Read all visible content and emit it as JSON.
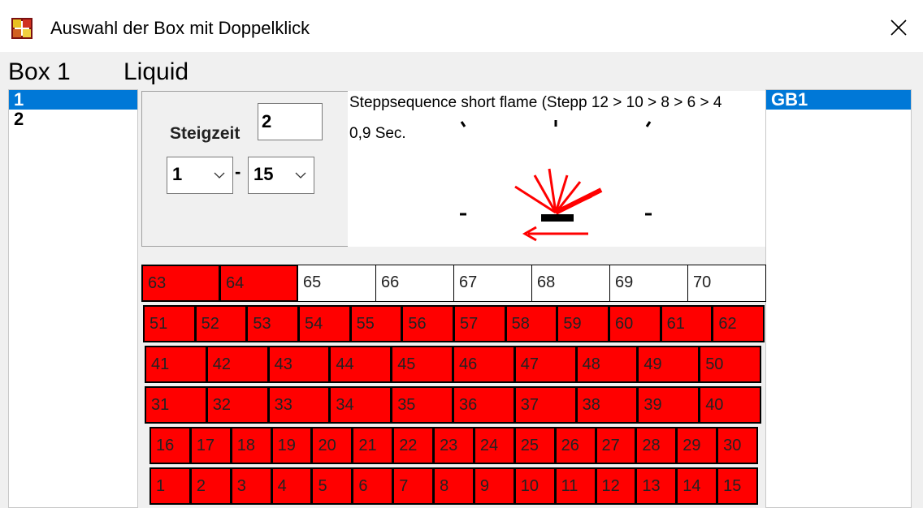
{
  "window": {
    "title": "Auswahl der Box mit Doppelklick"
  },
  "menu": {
    "box": "Box 1",
    "liquid": "Liquid"
  },
  "left_list": {
    "items": [
      "1",
      "2"
    ],
    "selected": "1"
  },
  "right_list": {
    "items": [
      "GB1"
    ],
    "selected": "GB1"
  },
  "controls": {
    "steigzeit_label": "Steigzeit",
    "steigzeit_value": "2",
    "range_from": "1",
    "range_to": "15",
    "dash": "-"
  },
  "preview": {
    "sequence_text": "Steppsequence short flame (Stepp 12 > 10 > 8 > 6 > 4",
    "duration_text": "0,9 Sec."
  },
  "colors": {
    "active": "#ff0000",
    "inactive": "#ffffff",
    "selection": "#0078d7"
  },
  "icons": {
    "app": "fireworks-app-icon",
    "close": "close-icon",
    "dropdown": "chevron-down-icon"
  },
  "grid": {
    "rows": [
      {
        "cells": [
          "63",
          "64",
          "65",
          "66",
          "67",
          "68",
          "69",
          "70"
        ],
        "active": [
          "63",
          "64"
        ]
      },
      {
        "cells": [
          "51",
          "52",
          "53",
          "54",
          "55",
          "56",
          "57",
          "58",
          "59",
          "60",
          "61",
          "62"
        ],
        "active": [
          "51",
          "52",
          "53",
          "54",
          "55",
          "56",
          "57",
          "58",
          "59",
          "60",
          "61",
          "62"
        ]
      },
      {
        "cells": [
          "41",
          "42",
          "43",
          "44",
          "45",
          "46",
          "47",
          "48",
          "49",
          "50"
        ],
        "active": [
          "41",
          "42",
          "43",
          "44",
          "45",
          "46",
          "47",
          "48",
          "49",
          "50"
        ]
      },
      {
        "cells": [
          "31",
          "32",
          "33",
          "34",
          "35",
          "36",
          "37",
          "38",
          "39",
          "40"
        ],
        "active": [
          "31",
          "32",
          "33",
          "34",
          "35",
          "36",
          "37",
          "38",
          "39",
          "40"
        ]
      },
      {
        "cells": [
          "16",
          "17",
          "18",
          "19",
          "20",
          "21",
          "22",
          "23",
          "24",
          "25",
          "26",
          "27",
          "28",
          "29",
          "30"
        ],
        "active": [
          "16",
          "17",
          "18",
          "19",
          "20",
          "21",
          "22",
          "23",
          "24",
          "25",
          "26",
          "27",
          "28",
          "29",
          "30"
        ]
      },
      {
        "cells": [
          "1",
          "2",
          "3",
          "4",
          "5",
          "6",
          "7",
          "8",
          "9",
          "10",
          "11",
          "12",
          "13",
          "14",
          "15"
        ],
        "active": [
          "1",
          "2",
          "3",
          "4",
          "5",
          "6",
          "7",
          "8",
          "9",
          "10",
          "11",
          "12",
          "13",
          "14",
          "15"
        ]
      }
    ]
  }
}
